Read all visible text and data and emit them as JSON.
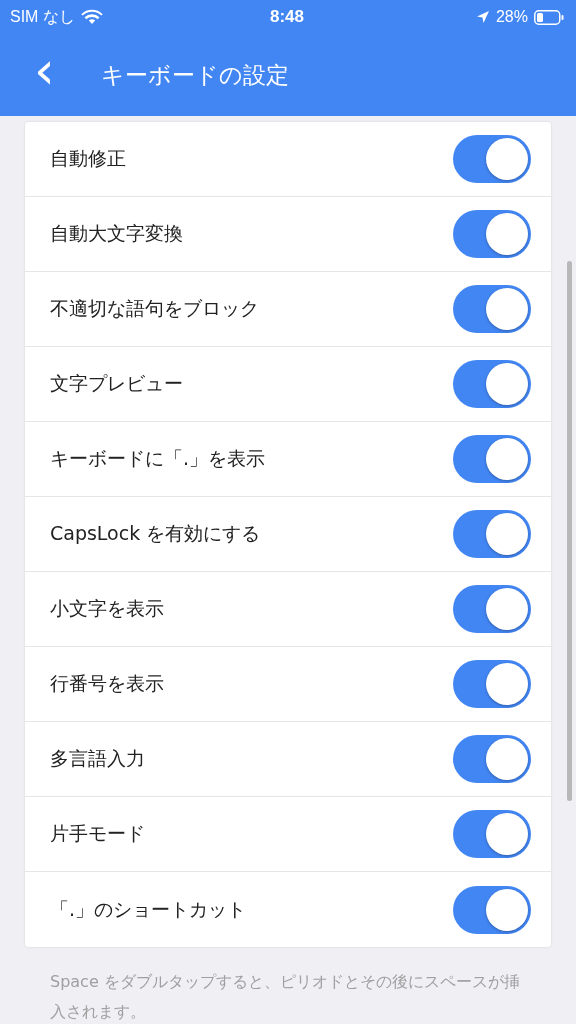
{
  "status_bar": {
    "carrier": "SIM なし",
    "time": "8:48",
    "battery": "28%"
  },
  "header": {
    "back": "‹",
    "title": "キーボードの設定"
  },
  "settings": [
    {
      "label": "自動修正",
      "on": true
    },
    {
      "label": "自動大文字変換",
      "on": true
    },
    {
      "label": "不適切な語句をブロック",
      "on": true
    },
    {
      "label": "文字プレビュー",
      "on": true
    },
    {
      "label": "キーボードに「.」を表示",
      "on": true
    },
    {
      "label": "CapsLock を有効にする",
      "on": true
    },
    {
      "label": "小文字を表示",
      "on": true
    },
    {
      "label": "行番号を表示",
      "on": true
    },
    {
      "label": "多言語入力",
      "on": true
    },
    {
      "label": "片手モード",
      "on": true
    },
    {
      "label": "「.」のショートカット",
      "on": true
    }
  ],
  "footnote": "Space をダブルタップすると、ピリオドとその後にスペースが挿入されます。"
}
